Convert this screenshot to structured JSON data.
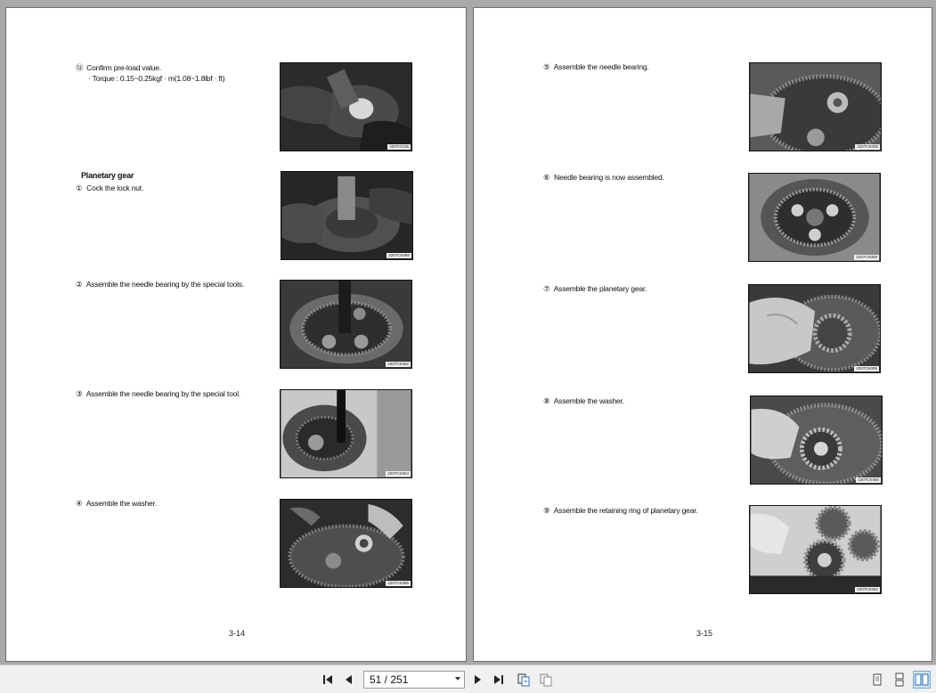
{
  "left_page": {
    "page_number": "3-14",
    "steps": [
      {
        "num": "⑫",
        "text": "Confirm pre-load value.",
        "sub": "· Torque : 0.15~0.25kgf · m(1.08~1.8lbf · ft)",
        "photo_code": "2207OC06"
      },
      {
        "num": "①",
        "text": "Cock the lock nut.",
        "photo_code": "2207CK050"
      },
      {
        "num": "②",
        "text": "Assemble the needle bearing by the special tools.",
        "photo_code": "2207CK052"
      },
      {
        "num": "③",
        "text": "Assemble the needle bearing by the special tool.",
        "photo_code": "2207CK054"
      },
      {
        "num": "④",
        "text": "Assemble the washer.",
        "photo_code": "2207CK055"
      }
    ],
    "heading": "Planetary gear"
  },
  "right_page": {
    "page_number": "3-15",
    "steps": [
      {
        "num": "⑤",
        "text": "Assemble the needle bearing.",
        "photo_code": "2207CK056"
      },
      {
        "num": "⑥",
        "text": "Needle bearing is now assembled.",
        "photo_code": "2207CK058"
      },
      {
        "num": "⑦",
        "text": "Assemble the planetary gear.",
        "photo_code": "2207CK059"
      },
      {
        "num": "⑧",
        "text": "Assemble the washer.",
        "photo_code": "2207CK060"
      },
      {
        "num": "⑨",
        "text": "Assemble the retaining ring of planetary gear.",
        "photo_code": "2207CK062"
      }
    ]
  },
  "toolbar": {
    "page_indicator": "51 / 251",
    "icons": [
      "first-page-icon",
      "prev-page-icon",
      "next-page-icon",
      "last-page-icon",
      "fit-width-icon",
      "fit-page-icon",
      "single-page-view-icon",
      "continuous-view-icon",
      "two-page-view-icon"
    ]
  }
}
